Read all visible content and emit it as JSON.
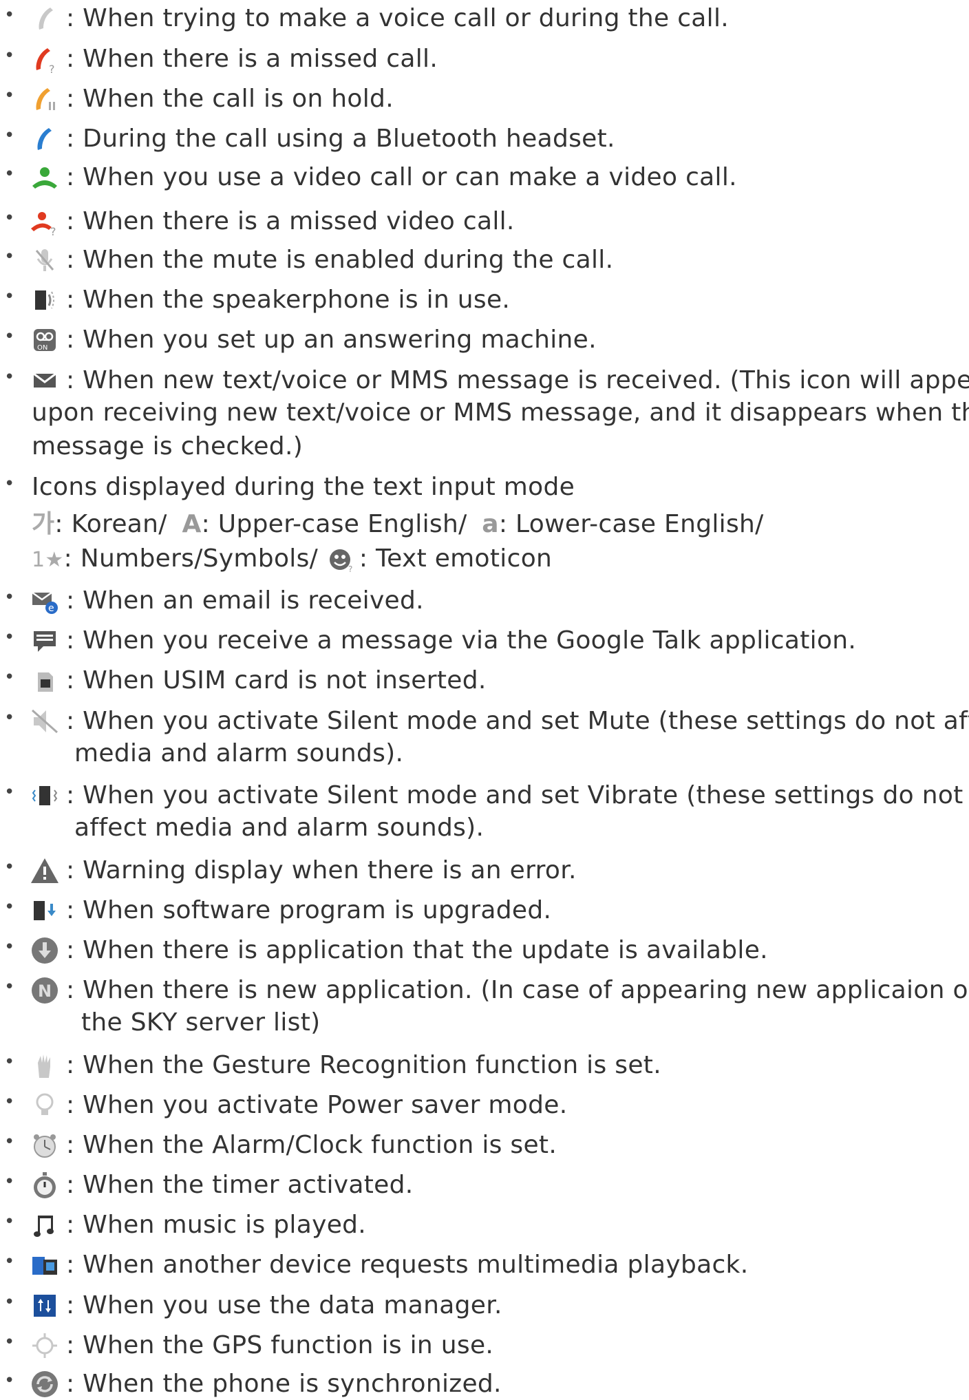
{
  "items": [
    {
      "icon": "phone-grey-icon",
      "text": ": When trying to make a voice call or during the call."
    },
    {
      "icon": "missed-call-icon",
      "text": ": When there is a missed call."
    },
    {
      "icon": "call-on-hold-icon",
      "text": ": When the call is on hold."
    },
    {
      "icon": "bluetooth-call-icon",
      "text": ": During the call using a Bluetooth headset."
    },
    {
      "icon": "video-call-icon",
      "text": ": When you use a video call or can make a video call."
    },
    {
      "icon": "missed-video-call-icon",
      "text": ": When there is a missed video call."
    },
    {
      "icon": "mute-mic-icon",
      "text": ": When the mute is enabled during the call."
    },
    {
      "icon": "speakerphone-icon",
      "text": ": When the speakerphone is in use."
    },
    {
      "icon": "answering-machine-icon",
      "text": ": When you set up an answering machine."
    },
    {
      "icon": "message-envelope-icon",
      "lines": [
        ": When new text/voice or MMS message is received. (This icon will appear",
        "upon receiving new text/voice or MMS message, and it disappears when the",
        "message is checked.)"
      ]
    },
    {
      "icon": "none",
      "text_mode": {
        "title": "Icons displayed during the text input mode",
        "korean_glyph": "가",
        "korean": ": Korean/",
        "upper_glyph": "A",
        "upper": ": Upper-case English/",
        "lower_glyph": "a",
        "lower": ": Lower-case English/",
        "numbers_glyph": "1★",
        "numbers": ": Numbers/Symbols/",
        "emoticon": ": Text emoticon"
      }
    },
    {
      "icon": "email-icon",
      "text": ": When an email is received."
    },
    {
      "icon": "google-talk-icon",
      "text": ": When you receive a message via the Google Talk application."
    },
    {
      "icon": "usim-icon",
      "text": ": When USIM card is not inserted."
    },
    {
      "icon": "silent-mute-icon",
      "lines": [
        ": When you activate Silent mode and set Mute (these settings do not affect",
        "media and alarm sounds)."
      ]
    },
    {
      "icon": "silent-vibrate-icon",
      "lines": [
        ": When you activate Silent mode and set Vibrate (these settings do not",
        "affect media and alarm sounds)."
      ]
    },
    {
      "icon": "warning-icon",
      "text": ": Warning display when there is an error."
    },
    {
      "icon": "software-upgrade-icon",
      "text": ": When software program is upgraded."
    },
    {
      "icon": "update-available-icon",
      "text": ": When there is application that the update is available."
    },
    {
      "icon": "new-application-icon",
      "lines": [
        ": When there is new application. (In case of appearing new applicaion on",
        "the SKY server list)"
      ]
    },
    {
      "icon": "gesture-icon",
      "text": ": When the Gesture Recognition function is set."
    },
    {
      "icon": "power-saver-icon",
      "text": ": When you activate Power saver mode."
    },
    {
      "icon": "alarm-clock-icon",
      "text": ": When the Alarm/Clock function is set."
    },
    {
      "icon": "timer-icon",
      "text": ": When the timer activated."
    },
    {
      "icon": "music-icon",
      "text": ": When music is played."
    },
    {
      "icon": "multimedia-playback-icon",
      "text": ": When another device requests multimedia playback."
    },
    {
      "icon": "data-manager-icon",
      "text": ": When you use the data manager."
    },
    {
      "icon": "gps-icon",
      "text": ": When the GPS function is in use."
    },
    {
      "icon": "sync-icon",
      "text": ": When the phone is synchronized."
    }
  ]
}
